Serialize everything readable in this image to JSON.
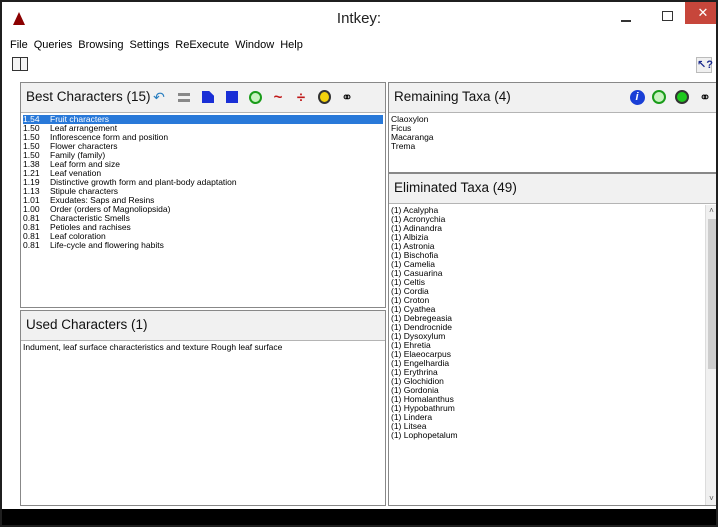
{
  "window": {
    "title": "Intkey:"
  },
  "menu": [
    "File",
    "Queries",
    "Browsing",
    "Settings",
    "ReExecute",
    "Window",
    "Help"
  ],
  "best_characters": {
    "title": "Best Characters (15)",
    "items": [
      {
        "score": "1.54",
        "name": "Fruit characters",
        "selected": true
      },
      {
        "score": "1.50",
        "name": "Leaf arrangement"
      },
      {
        "score": "1.50",
        "name": "Inflorescence form and position"
      },
      {
        "score": "1.50",
        "name": "Flower characters"
      },
      {
        "score": "1.50",
        "name": "Family (family)"
      },
      {
        "score": "1.38",
        "name": "Leaf form and size"
      },
      {
        "score": "1.21",
        "name": "Leaf venation"
      },
      {
        "score": "1.19",
        "name": "Distinctive growth form and plant-body adaptation"
      },
      {
        "score": "1.13",
        "name": "Stipule characters"
      },
      {
        "score": "1.01",
        "name": "Exudates: Saps and Resins"
      },
      {
        "score": "1.00",
        "name": "Order (orders of Magnoliopsida)"
      },
      {
        "score": "0.81",
        "name": "Characteristic Smells"
      },
      {
        "score": "0.81",
        "name": "Petioles and rachises"
      },
      {
        "score": "0.81",
        "name": "Leaf coloration"
      },
      {
        "score": "0.81",
        "name": "Life-cycle and flowering habits"
      }
    ]
  },
  "used_characters": {
    "title": "Used Characters (1)",
    "items": [
      "Indument, leaf surface characteristics and texture Rough leaf surface"
    ]
  },
  "remaining_taxa": {
    "title": "Remaining Taxa (4)",
    "items": [
      "Claoxylon",
      "Ficus",
      "Macaranga",
      "Trema"
    ]
  },
  "eliminated_taxa": {
    "title": "Eliminated Taxa (49)",
    "items": [
      "(1) Acalypha",
      "(1) Acronychia",
      "(1) Adinandra",
      "(1) Albizia",
      "(1) Astronia",
      "(1) Bischofia",
      "(1) Camelia",
      "(1) Casuarina",
      "(1) Celtis",
      "(1) Cordia",
      "(1) Croton",
      "(1) Cyathea",
      "(1) Debregeasia",
      "(1) Dendrocnide",
      "(1) Dysoxylum",
      "(1) Ehretia",
      "(1) Elaeocarpus",
      "(1) Engelhardia",
      "(1) Erythrina",
      "(1) Glochidion",
      "(1) Gordonia",
      "(1) Homalanthus",
      "(1) Hypobathrum",
      "(1) Lindera",
      "(1) Litsea",
      "(1) Lophopetalum"
    ]
  },
  "colors": {
    "selection": "#2979d9",
    "close_button": "#c7463b",
    "app_icon": "#8b0000"
  }
}
